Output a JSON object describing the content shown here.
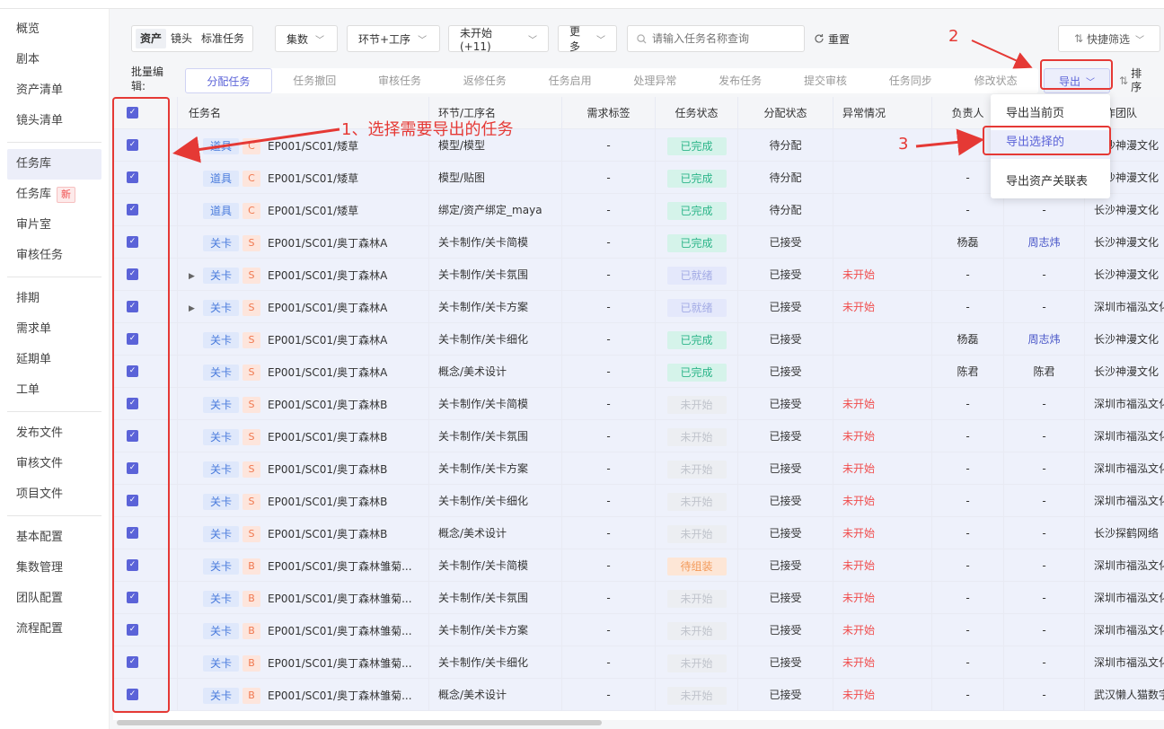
{
  "sidebar": {
    "group1": [
      "概览",
      "剧本",
      "资产清单",
      "镜头清单"
    ],
    "group2": [
      "任务库",
      "任务库",
      "审片室",
      "审核任务"
    ],
    "new_badge": "新",
    "group3": [
      "排期",
      "需求单",
      "延期单",
      "工单"
    ],
    "group4": [
      "发布文件",
      "审核文件",
      "项目文件"
    ],
    "group5": [
      "基本配置",
      "集数管理",
      "团队配置",
      "流程配置"
    ]
  },
  "toolbar": {
    "segment": [
      "资产",
      "镜头",
      "标准任务"
    ],
    "episode": "集数",
    "step": "环节+工序",
    "status_filter": "未开始(+11)",
    "more": "更多",
    "search_placeholder": "请输入任务名称查询",
    "reset": "重置",
    "quick_filter": "快捷筛选"
  },
  "batch": {
    "label": "批量编辑:",
    "tabs": [
      "分配任务",
      "任务撤回",
      "审核任务",
      "返修任务",
      "任务启用",
      "处理异常",
      "发布任务",
      "提交审核",
      "任务同步",
      "修改状态"
    ],
    "export": "导出",
    "sort": "排序"
  },
  "menu": {
    "items": [
      "导出当前页",
      "导出选择的",
      "导出资产关联表"
    ]
  },
  "table": {
    "headers": [
      "任务名",
      "环节/工序名",
      "需求标签",
      "任务状态",
      "分配状态",
      "异常情况",
      "负责人",
      "",
      "制作团队"
    ],
    "rows": [
      {
        "type": "道具",
        "grade": "C",
        "name": "EP001/SC01/矮草",
        "step": "模型/模型",
        "tag": "-",
        "status": "已完成",
        "st": "done",
        "assign": "待分配",
        "abn": "",
        "owner": "-",
        "owner2": "-",
        "team": "长沙神漫文化",
        "expand": false
      },
      {
        "type": "道具",
        "grade": "C",
        "name": "EP001/SC01/矮草",
        "step": "模型/贴图",
        "tag": "-",
        "status": "已完成",
        "st": "done",
        "assign": "待分配",
        "abn": "",
        "owner": "-",
        "owner2": "-",
        "team": "长沙神漫文化",
        "expand": false
      },
      {
        "type": "道具",
        "grade": "C",
        "name": "EP001/SC01/矮草",
        "step": "绑定/资产绑定_maya",
        "tag": "-",
        "status": "已完成",
        "st": "done",
        "assign": "待分配",
        "abn": "",
        "owner": "-",
        "owner2": "-",
        "team": "长沙神漫文化",
        "expand": false
      },
      {
        "type": "关卡",
        "grade": "S",
        "name": "EP001/SC01/奥丁森林A",
        "step": "关卡制作/关卡简模",
        "tag": "-",
        "status": "已完成",
        "st": "done",
        "assign": "已接受",
        "abn": "",
        "owner": "杨磊",
        "owner2": "周志炜",
        "team": "长沙神漫文化",
        "expand": false
      },
      {
        "type": "关卡",
        "grade": "S",
        "name": "EP001/SC01/奥丁森林A",
        "step": "关卡制作/关卡氛围",
        "tag": "-",
        "status": "已就绪",
        "st": "ready",
        "assign": "已接受",
        "abn": "未开始",
        "owner": "-",
        "owner2": "-",
        "team": "长沙神漫文化",
        "expand": true
      },
      {
        "type": "关卡",
        "grade": "S",
        "name": "EP001/SC01/奥丁森林A",
        "step": "关卡制作/关卡方案",
        "tag": "-",
        "status": "已就绪",
        "st": "ready",
        "assign": "已接受",
        "abn": "未开始",
        "owner": "-",
        "owner2": "-",
        "team": "深圳市福泓文化",
        "expand": true
      },
      {
        "type": "关卡",
        "grade": "S",
        "name": "EP001/SC01/奥丁森林A",
        "step": "关卡制作/关卡细化",
        "tag": "-",
        "status": "已完成",
        "st": "done",
        "assign": "已接受",
        "abn": "",
        "owner": "杨磊",
        "owner2": "周志炜",
        "team": "长沙神漫文化",
        "expand": false
      },
      {
        "type": "关卡",
        "grade": "S",
        "name": "EP001/SC01/奥丁森林A",
        "step": "概念/美术设计",
        "tag": "-",
        "status": "已完成",
        "st": "done",
        "assign": "已接受",
        "abn": "",
        "owner": "陈君",
        "owner2": "陈君",
        "team": "长沙神漫文化",
        "expand": false
      },
      {
        "type": "关卡",
        "grade": "S",
        "name": "EP001/SC01/奥丁森林B",
        "step": "关卡制作/关卡简模",
        "tag": "-",
        "status": "未开始",
        "st": "todo",
        "assign": "已接受",
        "abn": "未开始",
        "owner": "-",
        "owner2": "-",
        "team": "深圳市福泓文化",
        "expand": false
      },
      {
        "type": "关卡",
        "grade": "S",
        "name": "EP001/SC01/奥丁森林B",
        "step": "关卡制作/关卡氛围",
        "tag": "-",
        "status": "未开始",
        "st": "todo",
        "assign": "已接受",
        "abn": "未开始",
        "owner": "-",
        "owner2": "-",
        "team": "深圳市福泓文化",
        "expand": false
      },
      {
        "type": "关卡",
        "grade": "S",
        "name": "EP001/SC01/奥丁森林B",
        "step": "关卡制作/关卡方案",
        "tag": "-",
        "status": "未开始",
        "st": "todo",
        "assign": "已接受",
        "abn": "未开始",
        "owner": "-",
        "owner2": "-",
        "team": "深圳市福泓文化",
        "expand": false
      },
      {
        "type": "关卡",
        "grade": "S",
        "name": "EP001/SC01/奥丁森林B",
        "step": "关卡制作/关卡细化",
        "tag": "-",
        "status": "未开始",
        "st": "todo",
        "assign": "已接受",
        "abn": "未开始",
        "owner": "-",
        "owner2": "-",
        "team": "深圳市福泓文化",
        "expand": false
      },
      {
        "type": "关卡",
        "grade": "S",
        "name": "EP001/SC01/奥丁森林B",
        "step": "概念/美术设计",
        "tag": "-",
        "status": "未开始",
        "st": "todo",
        "assign": "已接受",
        "abn": "未开始",
        "owner": "-",
        "owner2": "-",
        "team": "长沙探鹤网络",
        "expand": false
      },
      {
        "type": "关卡",
        "grade": "B",
        "name": "EP001/SC01/奥丁森林雏菊...",
        "step": "关卡制作/关卡简模",
        "tag": "-",
        "status": "待组装",
        "st": "wait",
        "assign": "已接受",
        "abn": "未开始",
        "owner": "-",
        "owner2": "-",
        "team": "深圳市福泓文化",
        "expand": false
      },
      {
        "type": "关卡",
        "grade": "B",
        "name": "EP001/SC01/奥丁森林雏菊...",
        "step": "关卡制作/关卡氛围",
        "tag": "-",
        "status": "未开始",
        "st": "todo",
        "assign": "已接受",
        "abn": "未开始",
        "owner": "-",
        "owner2": "-",
        "team": "深圳市福泓文化",
        "expand": false
      },
      {
        "type": "关卡",
        "grade": "B",
        "name": "EP001/SC01/奥丁森林雏菊...",
        "step": "关卡制作/关卡方案",
        "tag": "-",
        "status": "未开始",
        "st": "todo",
        "assign": "已接受",
        "abn": "未开始",
        "owner": "-",
        "owner2": "-",
        "team": "深圳市福泓文化",
        "expand": false
      },
      {
        "type": "关卡",
        "grade": "B",
        "name": "EP001/SC01/奥丁森林雏菊...",
        "step": "关卡制作/关卡细化",
        "tag": "-",
        "status": "未开始",
        "st": "todo",
        "assign": "已接受",
        "abn": "未开始",
        "owner": "-",
        "owner2": "-",
        "team": "深圳市福泓文化",
        "expand": false
      },
      {
        "type": "关卡",
        "grade": "B",
        "name": "EP001/SC01/奥丁森林雏菊...",
        "step": "概念/美术设计",
        "tag": "-",
        "status": "未开始",
        "st": "todo",
        "assign": "已接受",
        "abn": "未开始",
        "owner": "-",
        "owner2": "-",
        "team": "武汉懒人猫数字",
        "expand": false
      }
    ]
  },
  "annotations": {
    "a1": "1、选择需要导出的任务",
    "a2": "2",
    "a3": "3",
    "color": "#e53935"
  },
  "colors": {
    "accent": "#5b63d8",
    "done": "#2db58a",
    "danger": "#f04d4d"
  }
}
